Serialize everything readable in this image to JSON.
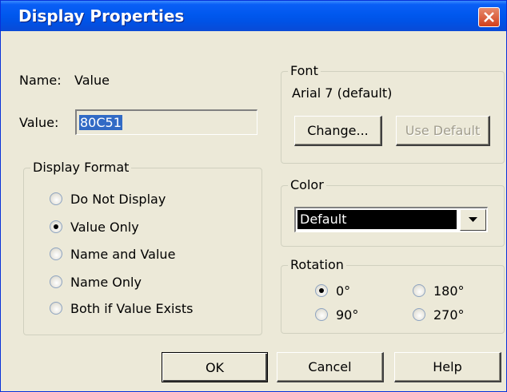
{
  "window": {
    "title": "Display Properties"
  },
  "name_row": {
    "label": "Name:",
    "value": "Value"
  },
  "value_row": {
    "label": "Value:",
    "value": "80C51"
  },
  "display_format": {
    "title": "Display Format",
    "options": [
      {
        "label": "Do Not Display",
        "checked": false
      },
      {
        "label": "Value Only",
        "checked": true
      },
      {
        "label": "Name and Value",
        "checked": false
      },
      {
        "label": "Name Only",
        "checked": false
      },
      {
        "label": "Both if Value Exists",
        "checked": false
      }
    ]
  },
  "font": {
    "title": "Font",
    "current": "Arial 7 (default)",
    "change_label": "Change...",
    "use_default_label": "Use Default"
  },
  "color": {
    "title": "Color",
    "selected": "Default",
    "swatch_color": "#000000"
  },
  "rotation": {
    "title": "Rotation",
    "options": [
      {
        "label": "0°",
        "checked": true
      },
      {
        "label": "180°",
        "checked": false
      },
      {
        "label": "90°",
        "checked": false
      },
      {
        "label": "270°",
        "checked": false
      }
    ]
  },
  "buttons": {
    "ok": "OK",
    "cancel": "Cancel",
    "help": "Help"
  }
}
